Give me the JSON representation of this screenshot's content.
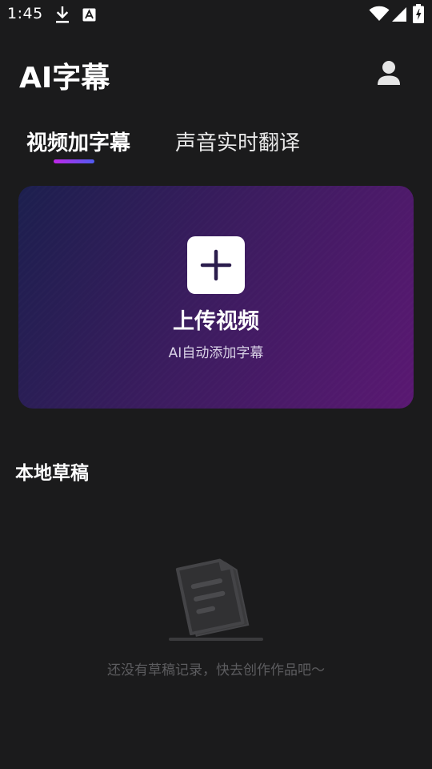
{
  "status_bar": {
    "time": "1:45",
    "icons": [
      "download-icon",
      "font-a-icon",
      "wifi-icon",
      "signal-icon",
      "battery-charging-icon"
    ]
  },
  "header": {
    "app_title": "AI字幕",
    "user_icon": "user-icon"
  },
  "tabs": [
    {
      "label": "视频加字幕",
      "active": true
    },
    {
      "label": "声音实时翻译",
      "active": false
    }
  ],
  "upload_card": {
    "icon": "plus-icon",
    "title": "上传视频",
    "subtitle": "AI自动添加字幕"
  },
  "drafts": {
    "title": "本地草稿",
    "empty_icon": "empty-document-icon",
    "empty_text": "还没有草稿记录，快去创作作品吧～"
  },
  "colors": {
    "background": "#1b1b1c",
    "card_gradient_start": "#1c1f4e",
    "card_gradient_end": "#5a1872",
    "tab_indicator_start": "#c026e8",
    "tab_indicator_end": "#4f5cf0",
    "muted_text": "#5c5c5f"
  }
}
